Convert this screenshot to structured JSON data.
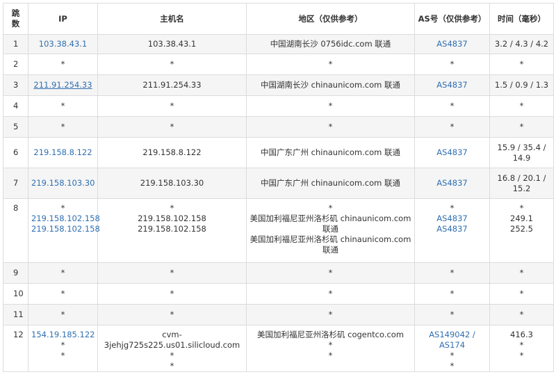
{
  "headers": {
    "hop": "跳\n数",
    "ip": "IP",
    "host": "主机名",
    "region": "地区（仅供参考）",
    "as": "AS号（仅供参考）",
    "time": "时间（毫秒）"
  },
  "rows": [
    {
      "hop": "1",
      "ip": [
        "103.38.43.1"
      ],
      "host": [
        "103.38.43.1"
      ],
      "region": [
        "中国湖南长沙 0756idc.com 联通"
      ],
      "as": [
        "AS4837"
      ],
      "time": [
        "3.2 / 4.3 / 4.2"
      ]
    },
    {
      "hop": "2",
      "ip": [
        "*"
      ],
      "host": [
        "*"
      ],
      "region": [
        "*"
      ],
      "as": [
        "*"
      ],
      "time": [
        "*"
      ]
    },
    {
      "hop": "3",
      "ip": [
        "211.91.254.33"
      ],
      "host": [
        "211.91.254.33"
      ],
      "region": [
        "中国湖南长沙 chinaunicom.com 联通"
      ],
      "as": [
        "AS4837"
      ],
      "time": [
        "1.5 / 0.9 / 1.3"
      ]
    },
    {
      "hop": "4",
      "ip": [
        "*"
      ],
      "host": [
        "*"
      ],
      "region": [
        "*"
      ],
      "as": [
        "*"
      ],
      "time": [
        "*"
      ]
    },
    {
      "hop": "5",
      "ip": [
        "*"
      ],
      "host": [
        "*"
      ],
      "region": [
        "*"
      ],
      "as": [
        "*"
      ],
      "time": [
        "*"
      ]
    },
    {
      "hop": "6",
      "ip": [
        "219.158.8.122"
      ],
      "host": [
        "219.158.8.122"
      ],
      "region": [
        "中国广东广州 chinaunicom.com 联通"
      ],
      "as": [
        "AS4837"
      ],
      "time": [
        "15.9 / 35.4 /",
        "14.9"
      ]
    },
    {
      "hop": "7",
      "ip": [
        "219.158.103.30"
      ],
      "host": [
        "219.158.103.30"
      ],
      "region": [
        "中国广东广州 chinaunicom.com 联通"
      ],
      "as": [
        "AS4837"
      ],
      "time": [
        "16.8 / 20.1 /",
        "15.2"
      ]
    },
    {
      "hop": "8",
      "ip": [
        "*",
        "219.158.102.158",
        "219.158.102.158"
      ],
      "host": [
        "*",
        "219.158.102.158",
        "219.158.102.158"
      ],
      "region": [
        "*",
        "美国加利福尼亚州洛杉矶 chinaunicom.com",
        "联通",
        "美国加利福尼亚州洛杉矶 chinaunicom.com",
        "联通"
      ],
      "as": [
        "*",
        "AS4837",
        "AS4837"
      ],
      "time": [
        "*",
        "249.1",
        "252.5"
      ]
    },
    {
      "hop": "9",
      "ip": [
        "*"
      ],
      "host": [
        "*"
      ],
      "region": [
        "*"
      ],
      "as": [
        "*"
      ],
      "time": [
        "*"
      ]
    },
    {
      "hop": "10",
      "ip": [
        "*"
      ],
      "host": [
        "*"
      ],
      "region": [
        "*"
      ],
      "as": [
        "*"
      ],
      "time": [
        "*"
      ]
    },
    {
      "hop": "11",
      "ip": [
        "*"
      ],
      "host": [
        "*"
      ],
      "region": [
        "*"
      ],
      "as": [
        "*"
      ],
      "time": [
        "*"
      ]
    },
    {
      "hop": "12",
      "ip": [
        "154.19.185.122",
        "*",
        "*"
      ],
      "host": [
        "cvm-",
        "3jehjg725s225.us01.silicloud.com",
        "*",
        "*"
      ],
      "region": [
        "美国加利福尼亚州洛杉矶 cogentco.com",
        "*",
        "*"
      ],
      "as": [
        "AS149042 /",
        "AS174",
        "*",
        "*"
      ],
      "time": [
        "416.3",
        "*",
        "*"
      ]
    }
  ],
  "colors": {
    "link": "#2f6fb0",
    "border": "#dcdcdc",
    "alt_row": "#f5f5f5"
  }
}
